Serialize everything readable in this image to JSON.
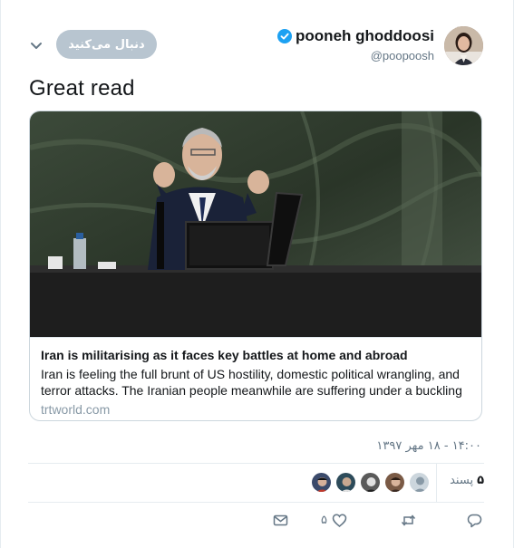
{
  "tweet": {
    "author": {
      "display_name": "pooneh ghoddoosi",
      "username": "@poopoosh",
      "verified": true,
      "avatar_icon": "user-avatar"
    },
    "follow_button_label": "دنبال می‌کنید",
    "text": "Great read",
    "timestamp": "۱۴:۰۰ - ۱۸ مهر ۱۳۹۷"
  },
  "card": {
    "title": "Iran is militarising as it faces key battles at home and abroad",
    "description": "Iran is feeling the full brunt of US hostility, domestic political wrangling, and terror attacks. The Iranian people meanwhile are suffering under a buckling economy -...",
    "domain": "trtworld.com",
    "image_icon": "article-photo"
  },
  "engagement": {
    "likes_count": "۵",
    "likes_label": "پسند",
    "liker_avatars": [
      "liker-avatar-1",
      "liker-avatar-2",
      "liker-avatar-3",
      "liker-avatar-4",
      "liker-avatar-5"
    ],
    "like_action_count": "۵"
  },
  "icons": {
    "chevron": "chevron-down-icon",
    "verified": "verified-badge-icon",
    "reply": "reply-icon",
    "retweet": "retweet-icon",
    "like": "heart-icon",
    "message": "direct-message-icon"
  },
  "colors": {
    "verified_blue": "#1da1f2",
    "follow_button_bg": "#b8c5d0",
    "secondary_text": "#657786"
  }
}
